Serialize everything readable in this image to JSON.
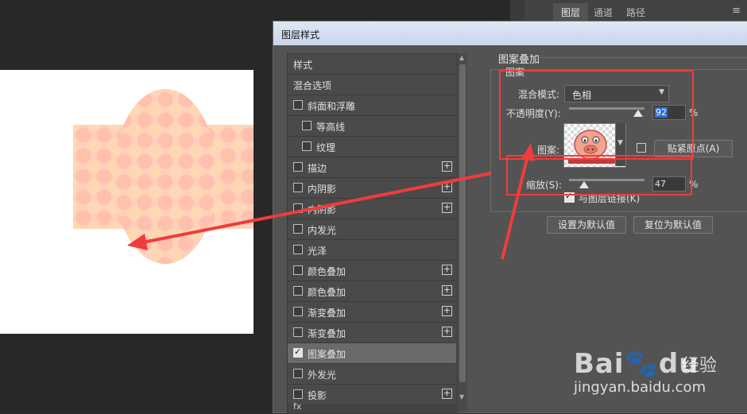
{
  "layers_panel": {
    "tabs": [
      {
        "label": "图层",
        "active": true
      },
      {
        "label": "通道",
        "active": false
      },
      {
        "label": "路径",
        "active": false
      }
    ],
    "menu_icon": "hamburger-icon"
  },
  "dialog": {
    "title": "图层样式",
    "style_list": [
      {
        "label": "样式",
        "checkbox": false,
        "checked": false,
        "plus": false,
        "indent": 0
      },
      {
        "label": "混合选项",
        "checkbox": false,
        "checked": false,
        "plus": false,
        "indent": 0
      },
      {
        "label": "斜面和浮雕",
        "checkbox": true,
        "checked": false,
        "plus": false,
        "indent": 0
      },
      {
        "label": "等高线",
        "checkbox": true,
        "checked": false,
        "plus": false,
        "indent": 1
      },
      {
        "label": "纹理",
        "checkbox": true,
        "checked": false,
        "plus": false,
        "indent": 1
      },
      {
        "label": "描边",
        "checkbox": true,
        "checked": false,
        "plus": true,
        "indent": 0
      },
      {
        "label": "内阴影",
        "checkbox": true,
        "checked": false,
        "plus": true,
        "indent": 0
      },
      {
        "label": "内阴影",
        "checkbox": true,
        "checked": false,
        "plus": true,
        "indent": 0
      },
      {
        "label": "内发光",
        "checkbox": true,
        "checked": false,
        "plus": false,
        "indent": 0
      },
      {
        "label": "光泽",
        "checkbox": true,
        "checked": false,
        "plus": false,
        "indent": 0
      },
      {
        "label": "颜色叠加",
        "checkbox": true,
        "checked": false,
        "plus": true,
        "indent": 0
      },
      {
        "label": "颜色叠加",
        "checkbox": true,
        "checked": false,
        "plus": true,
        "indent": 0
      },
      {
        "label": "渐变叠加",
        "checkbox": true,
        "checked": false,
        "plus": true,
        "indent": 0
      },
      {
        "label": "渐变叠加",
        "checkbox": true,
        "checked": false,
        "plus": true,
        "indent": 0
      },
      {
        "label": "图案叠加",
        "checkbox": true,
        "checked": true,
        "plus": false,
        "indent": 0,
        "selected": true
      },
      {
        "label": "外发光",
        "checkbox": true,
        "checked": false,
        "plus": false,
        "indent": 0
      },
      {
        "label": "投影",
        "checkbox": true,
        "checked": false,
        "plus": true,
        "indent": 0
      }
    ],
    "footer_fx": "fx",
    "pattern_overlay": {
      "group_title": "图案叠加",
      "subgroup_title": "图案",
      "blend_mode_label": "混合模式:",
      "blend_mode_value": "色相",
      "opacity_label": "不透明度(Y):",
      "opacity_value": "92",
      "opacity_unit": "%",
      "opacity_level": 0.92,
      "pattern_label": "图案:",
      "snap_origin_label": "贴紧原点(A)",
      "scale_label": "缩放(S):",
      "scale_value": "47",
      "scale_unit": "%",
      "scale_level": 0.2,
      "link_layer_label": "与图层链接(K)",
      "link_layer_checked": true,
      "make_default_label": "设置为默认值",
      "reset_default_label": "复位为默认值"
    }
  },
  "colors": {
    "annotation_red": "#f03c3c",
    "pattern_peach": "#ffd1bd",
    "highlight_blue": "#2d6fd6"
  },
  "watermark": {
    "logo": "Bai du",
    "cn": "经验",
    "url": "jingyan.baidu.com"
  }
}
